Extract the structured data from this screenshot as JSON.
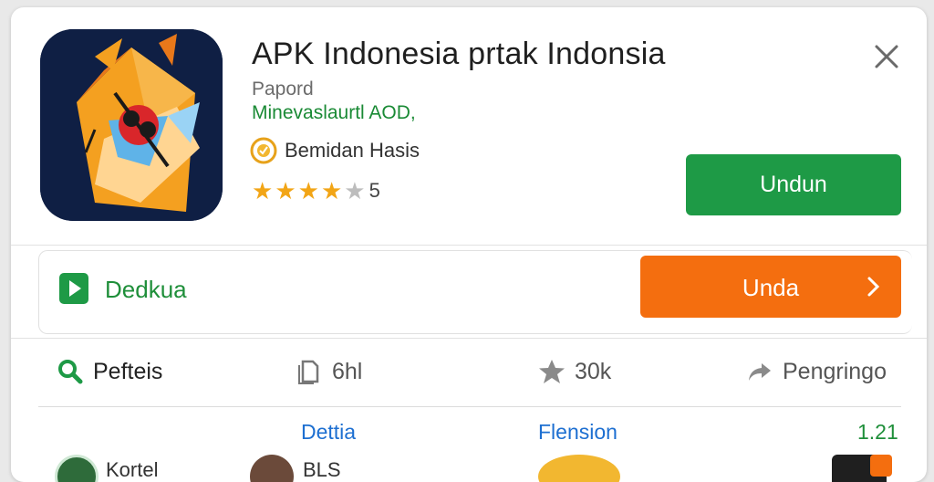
{
  "app": {
    "title": "APK Indonesia prtak Indonsia",
    "subtitle": "Papord",
    "developer": "Minevaslaurtl AOD,",
    "badge_label": "Bemidan Hasis",
    "rating_count": "5",
    "rating_stars": 4.5,
    "install_label": "Undun"
  },
  "promo": {
    "label": "Dedkua",
    "button_label": "Unda"
  },
  "stats": [
    {
      "icon": "search-icon",
      "label": "Pefteis"
    },
    {
      "icon": "file-icon",
      "label": "6hl"
    },
    {
      "icon": "star-icon",
      "label": "30k"
    },
    {
      "icon": "share-icon",
      "label": "Pengringo"
    }
  ],
  "tabs": {
    "details": "Dettia",
    "version_tab": "Flension",
    "version_value": "1.21"
  },
  "bottom": {
    "item1": "Kortel",
    "item2": "BLS"
  },
  "colors": {
    "green": "#1e9a46",
    "orange": "#f46e0f",
    "blue": "#1d6fd1",
    "star": "#f2a516",
    "icon_bg": "#0f1f44"
  }
}
